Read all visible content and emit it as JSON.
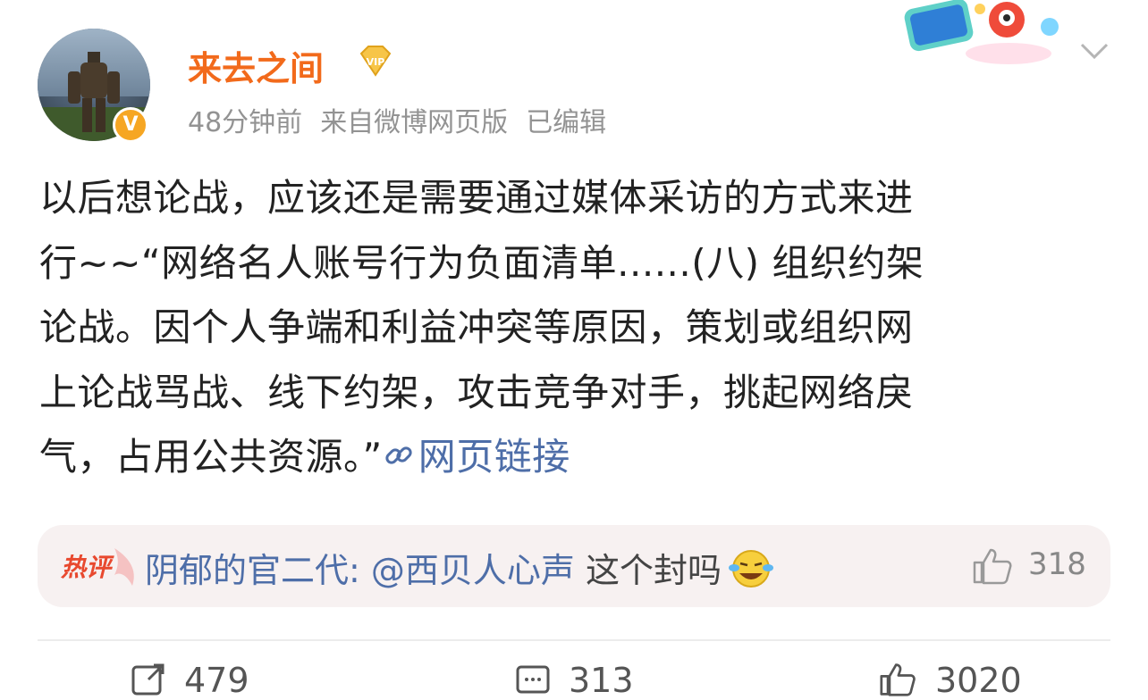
{
  "post": {
    "username": "来去之间",
    "time": "48分钟前",
    "source": "来自微博网页版",
    "edited": "已编辑",
    "content_line1": "以后想论战，应该还是需要通过媒体采访的方式来进",
    "content_line2": "行~~“网络名人账号行为负面清单......(八) 组织约架",
    "content_line3": "论战。因个人争端和利益冲突等原因，策划或组织网",
    "content_line4": "上论战骂战、线下约架，攻击竞争对手，挑起网络戾",
    "content_line5": "气，占用公共资源。”",
    "link_label": "网页链接"
  },
  "hot_comment": {
    "tag": "热评",
    "user": "阴郁的官二代:",
    "mention": "@西贝人心声",
    "text": " 这个封吗",
    "likes": "318"
  },
  "actions": {
    "repost_count": "479",
    "comment_count": "313",
    "like_count": "3020"
  },
  "icons": [
    "verified-v-icon",
    "vip-diamond-icon",
    "chevron-down-icon",
    "link-icon",
    "laugh-cry-emoji-icon",
    "thumbs-up-icon",
    "repost-icon",
    "comment-icon"
  ],
  "colors": {
    "username": "#f26a1b",
    "link": "#4e6ea8",
    "meta": "#939393",
    "hot_tag": "#e8492f",
    "hot_bg": "#f7f1f1"
  }
}
